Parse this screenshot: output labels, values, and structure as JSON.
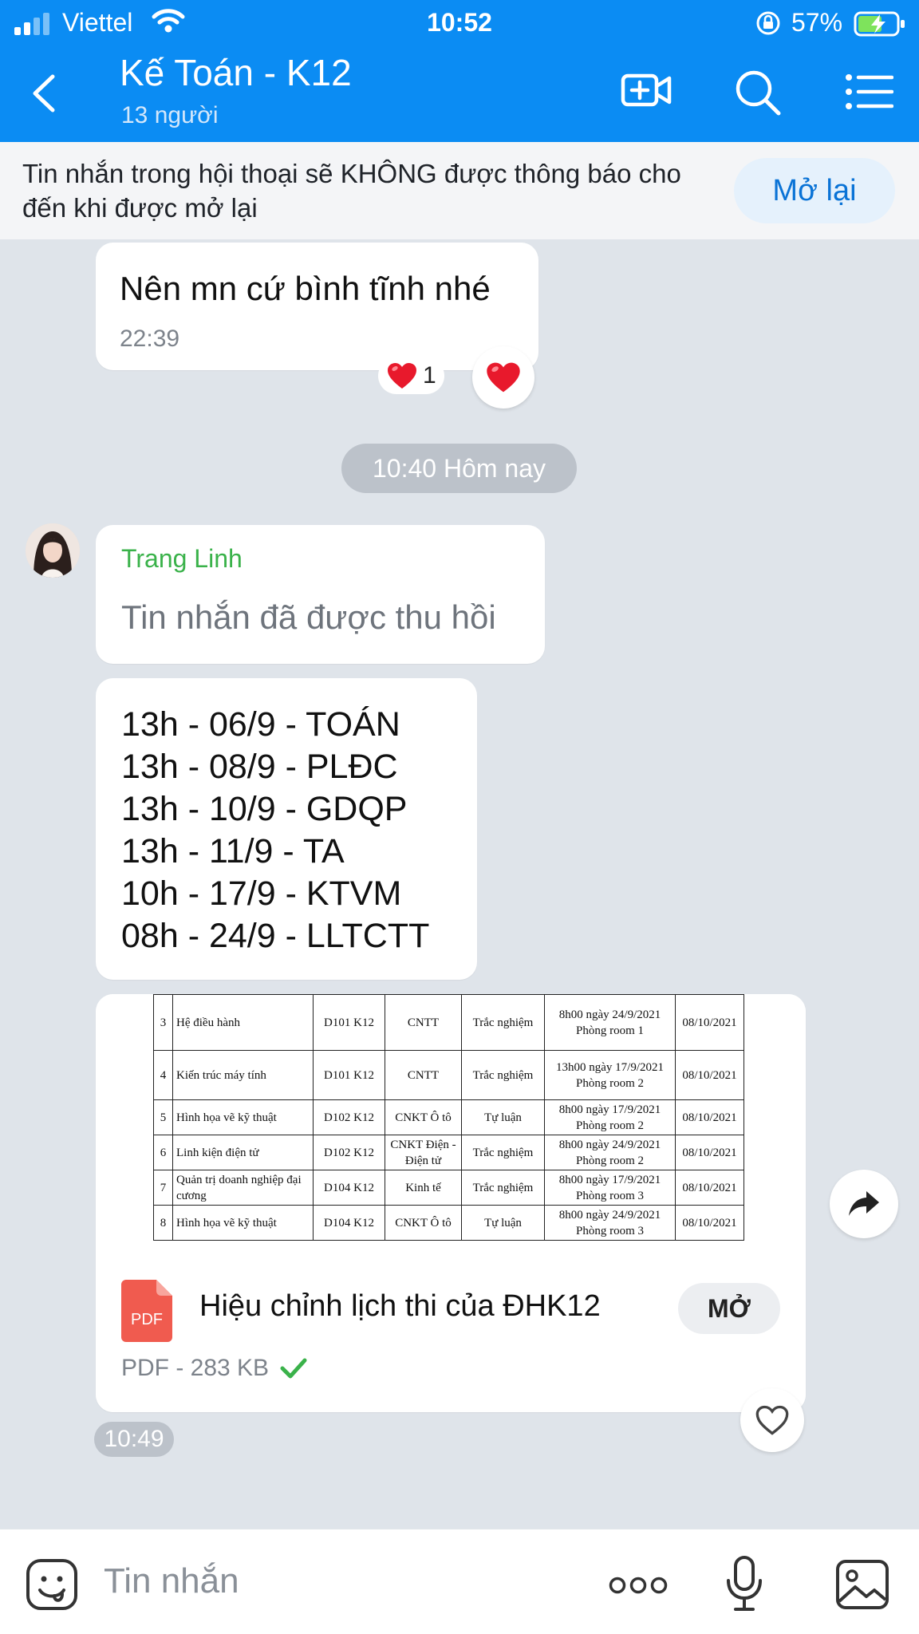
{
  "status": {
    "carrier": "Viettel",
    "time": "10:52",
    "battery": "57%"
  },
  "header": {
    "title": "Kế Toán - K12",
    "members": "13 người"
  },
  "banner": {
    "text": "Tin nhắn trong hội thoại sẽ KHÔNG được thông báo cho đến khi được mở lại",
    "button": "Mở lại"
  },
  "messages": {
    "m1": {
      "text": "Nên mn cứ bình tĩnh nhé",
      "time": "22:39",
      "reaction_count": "1"
    },
    "date_divider": "10:40 Hôm nay",
    "m2": {
      "sender": "Trang Linh",
      "text": "Tin nhắn đã được thu hồi"
    },
    "m3": {
      "lines": [
        "13h - 06/9 - TOÁN",
        "13h - 08/9 - PLĐC",
        "13h - 10/9 - GDQP",
        "13h - 11/9 - TA",
        "10h - 17/9 - KTVM",
        "08h - 24/9 - LLTCTT"
      ]
    },
    "m4": {
      "preview_rows": [
        [
          "3",
          "Hệ điều hành",
          "D101 K12",
          "CNTT",
          "Trắc nghiệm",
          "8h00 ngày 24/9/2021 Phòng room 1",
          "08/10/2021"
        ],
        [
          "4",
          "Kiến trúc máy tính",
          "D101 K12",
          "CNTT",
          "Trắc nghiệm",
          "13h00 ngày 17/9/2021 Phòng room 2",
          "08/10/2021"
        ],
        [
          "5",
          "Hình họa vẽ kỹ thuật",
          "D102 K12",
          "CNKT Ô tô",
          "Tự luận",
          "8h00 ngày 17/9/2021 Phòng room 2",
          "08/10/2021"
        ],
        [
          "6",
          "Linh kiện điện tử",
          "D102 K12",
          "CNKT Điện - Điện tử",
          "Trắc nghiệm",
          "8h00 ngày 24/9/2021 Phòng room 2",
          "08/10/2021"
        ],
        [
          "7",
          "Quản trị doanh nghiệp đại cương",
          "D104 K12",
          "Kinh tế",
          "Trắc nghiệm",
          "8h00 ngày 17/9/2021 Phòng room 3",
          "08/10/2021"
        ],
        [
          "8",
          "Hình họa vẽ kỹ thuật",
          "D104 K12",
          "CNKT Ô tô",
          "Tự luận",
          "8h00 ngày 24/9/2021 Phòng room 3",
          "08/10/2021"
        ]
      ],
      "file_label": "PDF",
      "file_name": "Hiệu chỉnh lịch thi của ĐHK12",
      "open_button": "MỞ",
      "meta": "PDF - 283 KB",
      "time": "10:49"
    }
  },
  "composer": {
    "placeholder": "Tin nhắn",
    "more": "ooo"
  },
  "colors": {
    "header": "#0b8cf3",
    "accent": "#0a73d6",
    "background": "#dfe4ea",
    "sender": "#3ab24a",
    "pdf": "#f05b4f"
  }
}
